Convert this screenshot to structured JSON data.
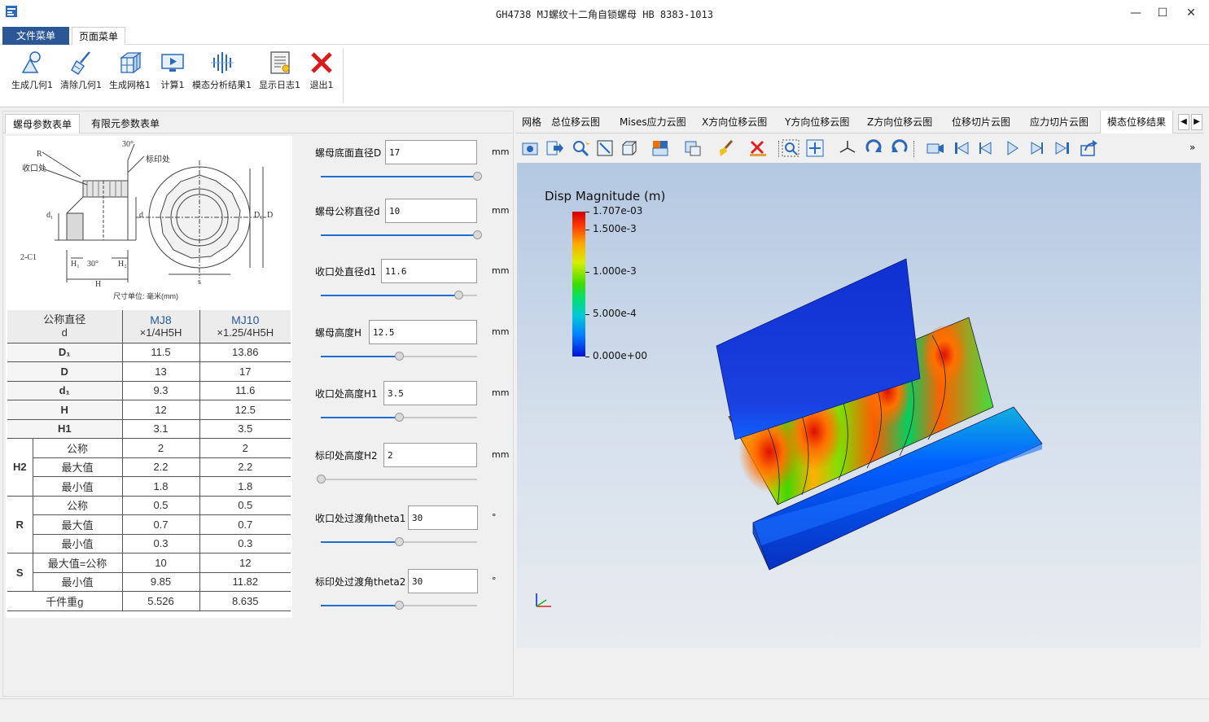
{
  "window": {
    "title": "GH4738 MJ螺纹十二角自锁螺母 HB 8383-1013",
    "minimize": "—",
    "maximize": "☐",
    "close": "✕"
  },
  "menu_tabs": [
    {
      "label": "文件菜单",
      "active": false
    },
    {
      "label": "页面菜单",
      "active": true
    }
  ],
  "ribbon": [
    {
      "label": "生成几何1",
      "icon": "geometry-icon"
    },
    {
      "label": "清除几何1",
      "icon": "broom-icon"
    },
    {
      "label": "生成网格1",
      "icon": "mesh-cube-icon"
    },
    {
      "label": "计算1",
      "icon": "compute-monitor-icon"
    },
    {
      "label": "模态分析结果1",
      "icon": "modal-analysis-icon"
    },
    {
      "label": "显示日志1",
      "icon": "log-icon"
    },
    {
      "label": "退出1",
      "icon": "exit-x-icon"
    }
  ],
  "left_tabs": [
    {
      "label": "螺母参数表单",
      "active": true
    },
    {
      "label": "有限元参数表单",
      "active": false
    }
  ],
  "drawing_labels": {
    "R": "R",
    "shrink": "收口处",
    "mark": "标印处",
    "angle30": "30°",
    "d1": "d₁",
    "d": "d",
    "D1": "D₁",
    "D": "D",
    "chamfer": "2-C1",
    "H1": "H₁",
    "H2": "H₂",
    "angle30b": "30°",
    "H": "H",
    "s": "s",
    "units": "尺寸单位: 毫米(mm)"
  },
  "spec_table": {
    "header": {
      "col0_line1": "公称直径",
      "col0_line2": "d",
      "col1_line1": "MJ8",
      "col1_line2": "×1/4H5H",
      "col2_line1": "MJ10",
      "col2_line2": "×1.25/4H5H"
    },
    "rows": [
      {
        "name": "D₁",
        "v1": "11.5",
        "v2": "13.86"
      },
      {
        "name": "D",
        "v1": "13",
        "v2": "17"
      },
      {
        "name": "d₁",
        "v1": "9.3",
        "v2": "11.6"
      },
      {
        "name": "H",
        "v1": "12",
        "v2": "12.5"
      },
      {
        "name": "H1",
        "v1": "3.1",
        "v2": "3.5"
      }
    ],
    "groups": [
      {
        "group": "H2",
        "rows": [
          {
            "name": "公称",
            "v1": "2",
            "v2": "2"
          },
          {
            "name": "最大值",
            "v1": "2.2",
            "v2": "2.2"
          },
          {
            "name": "最小值",
            "v1": "1.8",
            "v2": "1.8"
          }
        ]
      },
      {
        "group": "R",
        "rows": [
          {
            "name": "公称",
            "v1": "0.5",
            "v2": "0.5"
          },
          {
            "name": "最大值",
            "v1": "0.7",
            "v2": "0.7"
          },
          {
            "name": "最小值",
            "v1": "0.3",
            "v2": "0.3"
          }
        ]
      },
      {
        "group": "S",
        "rows": [
          {
            "name": "最大值=公称",
            "v1": "10",
            "v2": "12"
          },
          {
            "name": "最小值",
            "v1": "9.85",
            "v2": "11.82"
          }
        ]
      }
    ],
    "weight": {
      "name": "千件重g",
      "v1": "5.526",
      "v2": "8.635"
    }
  },
  "params": [
    {
      "label": "螺母底面直径D",
      "value": "17",
      "unit": "mm",
      "slider": 1.0
    },
    {
      "label": "螺母公称直径d",
      "value": "10",
      "unit": "mm",
      "slider": 1.0
    },
    {
      "label": "收口处直径d1",
      "value": "11.6",
      "unit": "mm",
      "slider": 0.88
    },
    {
      "label": "螺母高度H",
      "value": "12.5",
      "unit": "mm",
      "slider": 0.5
    },
    {
      "label": "收口处高度H1",
      "value": "3.5",
      "unit": "mm",
      "slider": 0.5
    },
    {
      "label": "标印处高度H2",
      "value": "2",
      "unit": "mm",
      "slider": 0.0
    },
    {
      "label": "收口处过渡角theta1",
      "value": "30",
      "unit": "°",
      "slider": 0.5
    },
    {
      "label": "标印处过渡角theta2",
      "value": "30",
      "unit": "°",
      "slider": 0.5
    }
  ],
  "result_tabs": [
    {
      "label": "网格",
      "active": false
    },
    {
      "label": "总位移云图",
      "active": false
    },
    {
      "label": "Mises应力云图",
      "active": false
    },
    {
      "label": "X方向位移云图",
      "active": false
    },
    {
      "label": "Y方向位移云图",
      "active": false
    },
    {
      "label": "Z方向位移云图",
      "active": false
    },
    {
      "label": "位移切片云图",
      "active": false
    },
    {
      "label": "应力切片云图",
      "active": false
    },
    {
      "label": "模态位移结果",
      "active": true
    }
  ],
  "tab_nav": {
    "prev": "◀",
    "next": "▶",
    "more": "»"
  },
  "viewer_tools": [
    "camera-icon",
    "export-arrow-icon",
    "magic-zoom-icon",
    "fit-box-icon",
    "cube-outline-icon",
    "color-box-icon",
    "select-box-icon",
    "brush-icon",
    "clear-x-icon",
    "zoom-region-icon",
    "pan-icon",
    "axes-icon",
    "rotate-cw-icon",
    "rotate-ccw-icon",
    "video-camera-icon",
    "first-frame-icon",
    "prev-frame-icon",
    "play-icon",
    "next-frame-icon",
    "last-frame-icon",
    "share-icon"
  ],
  "legend": {
    "title": "Disp Magnitude (m)",
    "max": "1.707e-03",
    "ticks": [
      "1.500e-3",
      "1.000e-3",
      "5.000e-4"
    ],
    "min": "0.000e+00",
    "max_value": 0.001707,
    "tick_values": [
      0.0015,
      0.001,
      0.0005
    ]
  },
  "colors": {
    "menu_active": "#2b5797",
    "slider_fill": "#1e6fd0",
    "mj_blue": "#2a5aa0"
  }
}
